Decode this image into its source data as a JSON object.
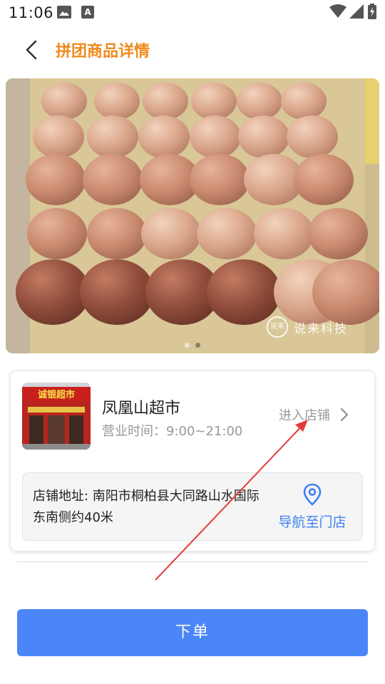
{
  "status_bar": {
    "time": "11:06",
    "icons": [
      "image-icon",
      "a-icon",
      "wifi-icon",
      "signal-icon",
      "battery-icon"
    ]
  },
  "header": {
    "title": "拼团商品详情",
    "back_icon": "chevron-left-icon",
    "title_color": "#f08a1c"
  },
  "product": {
    "watermark_logo": "说来",
    "watermark_text": "说来科技",
    "carousel": {
      "pages": 2,
      "active": 2
    }
  },
  "store": {
    "thumb_sign": "诚银超市",
    "name": "凤凰山超市",
    "hours": "营业时间：9:00~21:00",
    "enter_label": "进入店铺",
    "address": "店铺地址: 南阳市桐柏县大同路山水国际东南侧约40米",
    "navigate_label": "导航至门店",
    "accent_color": "#3d80f2"
  },
  "order_button": {
    "label": "下单",
    "color": "#4a86f7"
  },
  "annotation": {
    "arrow_color": "#e33b3b"
  }
}
